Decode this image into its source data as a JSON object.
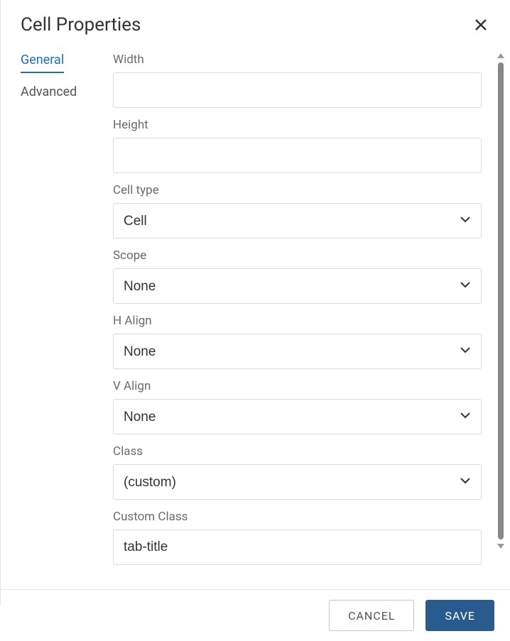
{
  "dialog": {
    "title": "Cell Properties"
  },
  "tabs": {
    "general": "General",
    "advanced": "Advanced"
  },
  "fields": {
    "width": {
      "label": "Width",
      "value": ""
    },
    "height": {
      "label": "Height",
      "value": ""
    },
    "cell_type": {
      "label": "Cell type",
      "value": "Cell"
    },
    "scope": {
      "label": "Scope",
      "value": "None"
    },
    "h_align": {
      "label": "H Align",
      "value": "None"
    },
    "v_align": {
      "label": "V Align",
      "value": "None"
    },
    "class": {
      "label": "Class",
      "value": "(custom)"
    },
    "custom_class": {
      "label": "Custom Class",
      "value": "tab-title"
    }
  },
  "buttons": {
    "cancel": "CANCEL",
    "save": "SAVE"
  }
}
